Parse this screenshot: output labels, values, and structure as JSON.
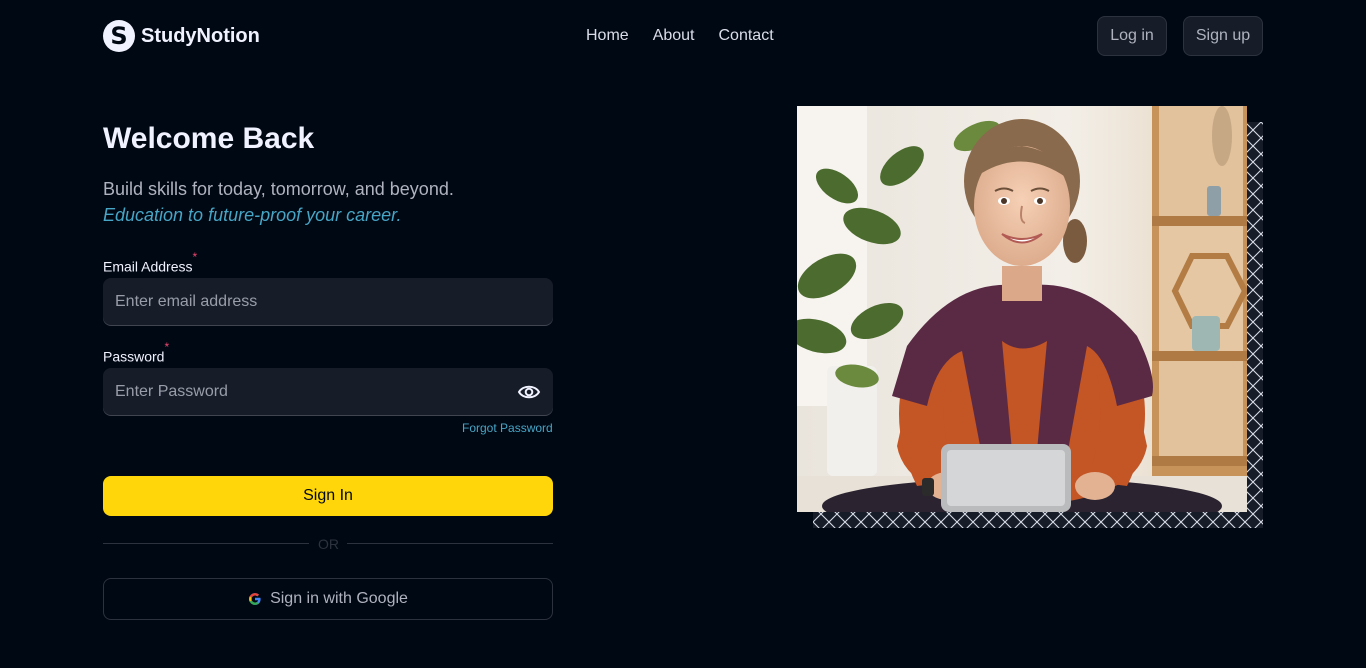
{
  "brand": {
    "name": "StudyNotion",
    "logo_letter": "S"
  },
  "nav": {
    "links": [
      "Home",
      "About",
      "Contact"
    ],
    "login_label": "Log in",
    "signup_label": "Sign up"
  },
  "form": {
    "title": "Welcome Back",
    "subtitle": "Build skills for today, tomorrow, and beyond.",
    "tagline": "Education to future-proof your career.",
    "email_label": "Email Address",
    "email_placeholder": "Enter email address",
    "password_label": "Password",
    "password_placeholder": "Enter Password",
    "required_mark": "*",
    "forgot": "Forgot Password",
    "signin_label": "Sign In",
    "or": "OR",
    "google_label": "Sign in with Google"
  },
  "colors": {
    "background": "#000814",
    "accent_yellow": "#FFD60A",
    "link_blue": "#47A5C5",
    "required_red": "#EF476F",
    "field_bg": "#161D29"
  },
  "icons": [
    "logo-icon",
    "eye-icon",
    "google-icon",
    "student-photo",
    "cross-pattern-frame"
  ]
}
